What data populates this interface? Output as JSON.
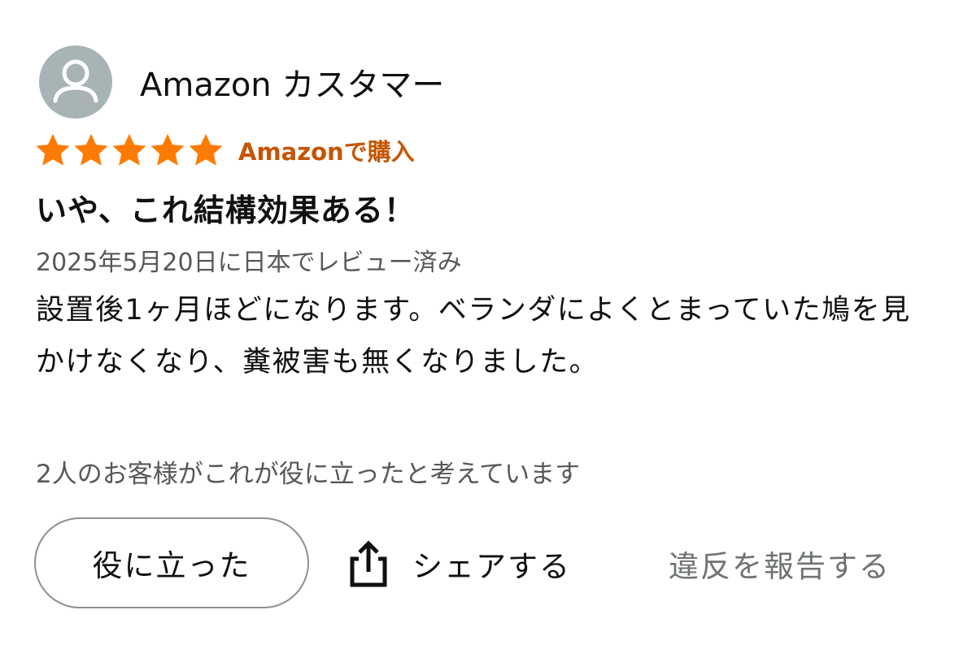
{
  "reviewer": {
    "name": "Amazon カスタマー",
    "avatar_icon": "default-user-avatar-icon"
  },
  "rating": {
    "stars": 5,
    "max_stars": 5,
    "star_color": "#ff7a00",
    "verified_label": "Amazonで購入"
  },
  "review": {
    "title": "いや、これ結構効果ある！",
    "date": "2025年5月20日に日本でレビュー済み",
    "body": "設置後1ヶ月ほどになります。ベランダによくとまっていた鳩を見かけなくなり、糞被害も無くなりました。"
  },
  "helpful": {
    "count_text": "2人のお客様がこれが役に立ったと考えています"
  },
  "actions": {
    "helpful_label": "役に立った",
    "share_label": "シェアする",
    "share_icon": "share-icon",
    "report_label": "違反を報告する"
  },
  "colors": {
    "accent": "#c45500",
    "star": "#ff7a00",
    "secondary_text": "#565959",
    "avatar_bg": "#a8b3b5"
  }
}
